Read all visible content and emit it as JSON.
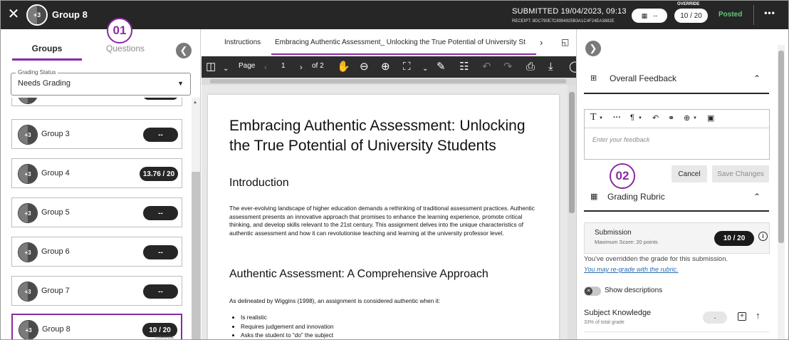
{
  "header": {
    "title": "Group 8",
    "avatar_count": "+3",
    "submitted": "SUBMITTED 19/04/2023, 09:13",
    "receipt": "RECEIPT: 8DC790E7C8994925B3A1C4F24EA3882E",
    "grid_pill_text": "--",
    "override_label": "OVERRIDE",
    "score": "10 / 20",
    "status": "Posted",
    "more": "•••",
    "close": "✕"
  },
  "callouts": {
    "one": "01",
    "two": "02"
  },
  "left_panel": {
    "tabs": {
      "groups": "Groups",
      "questions": "Questions"
    },
    "grading_status": {
      "label": "Grading Status",
      "value": "Needs Grading"
    },
    "groups": [
      {
        "name": "Group 3",
        "score": "--",
        "count": "+3",
        "selected": false,
        "override": ""
      },
      {
        "name": "Group 4",
        "score": "13.76 / 20",
        "count": "+3",
        "selected": false,
        "override": ""
      },
      {
        "name": "Group 5",
        "score": "--",
        "count": "+3",
        "selected": false,
        "override": ""
      },
      {
        "name": "Group 6",
        "score": "--",
        "count": "+3",
        "selected": false,
        "override": ""
      },
      {
        "name": "Group 7",
        "score": "--",
        "count": "+3",
        "selected": false,
        "override": ""
      },
      {
        "name": "Group 8",
        "score": "10 / 20",
        "count": "+3",
        "selected": true,
        "override": "OVERRIDE"
      }
    ]
  },
  "document": {
    "tabs": {
      "instructions": "Instructions",
      "document": "Embracing Authentic Assessment_ Unlocking the True Potential of University St"
    },
    "toolbar": {
      "page_label": "Page",
      "page_number": "1",
      "page_of": "of 2"
    },
    "title": "Embracing Authentic Assessment: Unlocking the True Potential of University Students",
    "heading_intro": "Introduction",
    "intro_text": "The ever-evolving landscape of higher education demands a rethinking of traditional assessment practices. Authentic assessment presents an innovative approach that promises to enhance the learning experience, promote critical thinking, and develop skills relevant to the 21st century. This assignment delves into the unique characteristics of authentic assessment and how it can revolutionise teaching and learning at the university professor level.",
    "heading_aa": "Authentic Assessment: A Comprehensive Approach",
    "aa_text": "As delineated by Wiggins (1998), an assignment is considered authentic when it:",
    "aa_list": [
      "Is realistic",
      "Requires judgement and innovation",
      "Asks the student to “do” the subject"
    ]
  },
  "right_panel": {
    "overall_feedback": {
      "title": "Overall Feedback"
    },
    "editor": {
      "placeholder": "Enter your feedback"
    },
    "buttons": {
      "cancel": "Cancel",
      "save": "Save Changes"
    },
    "rubric": {
      "title": "Grading Rubric"
    },
    "submission": {
      "label": "Submission",
      "max_score": "Maximum Score: 20 points",
      "score": "10 / 20",
      "info": "i"
    },
    "override_message": "You've overridden the grade for this submission.",
    "regrade_link": "You may re-grade with the rubric.",
    "show_descriptions": "Show descriptions",
    "criterion": {
      "name": "Subject Knowledge",
      "weight": "33% of total grade",
      "score": "-"
    }
  },
  "colors": {
    "accent": "#8a2aa4",
    "header_bg": "#262626",
    "posted": "#5fc87a",
    "link": "#2b6cb0"
  }
}
